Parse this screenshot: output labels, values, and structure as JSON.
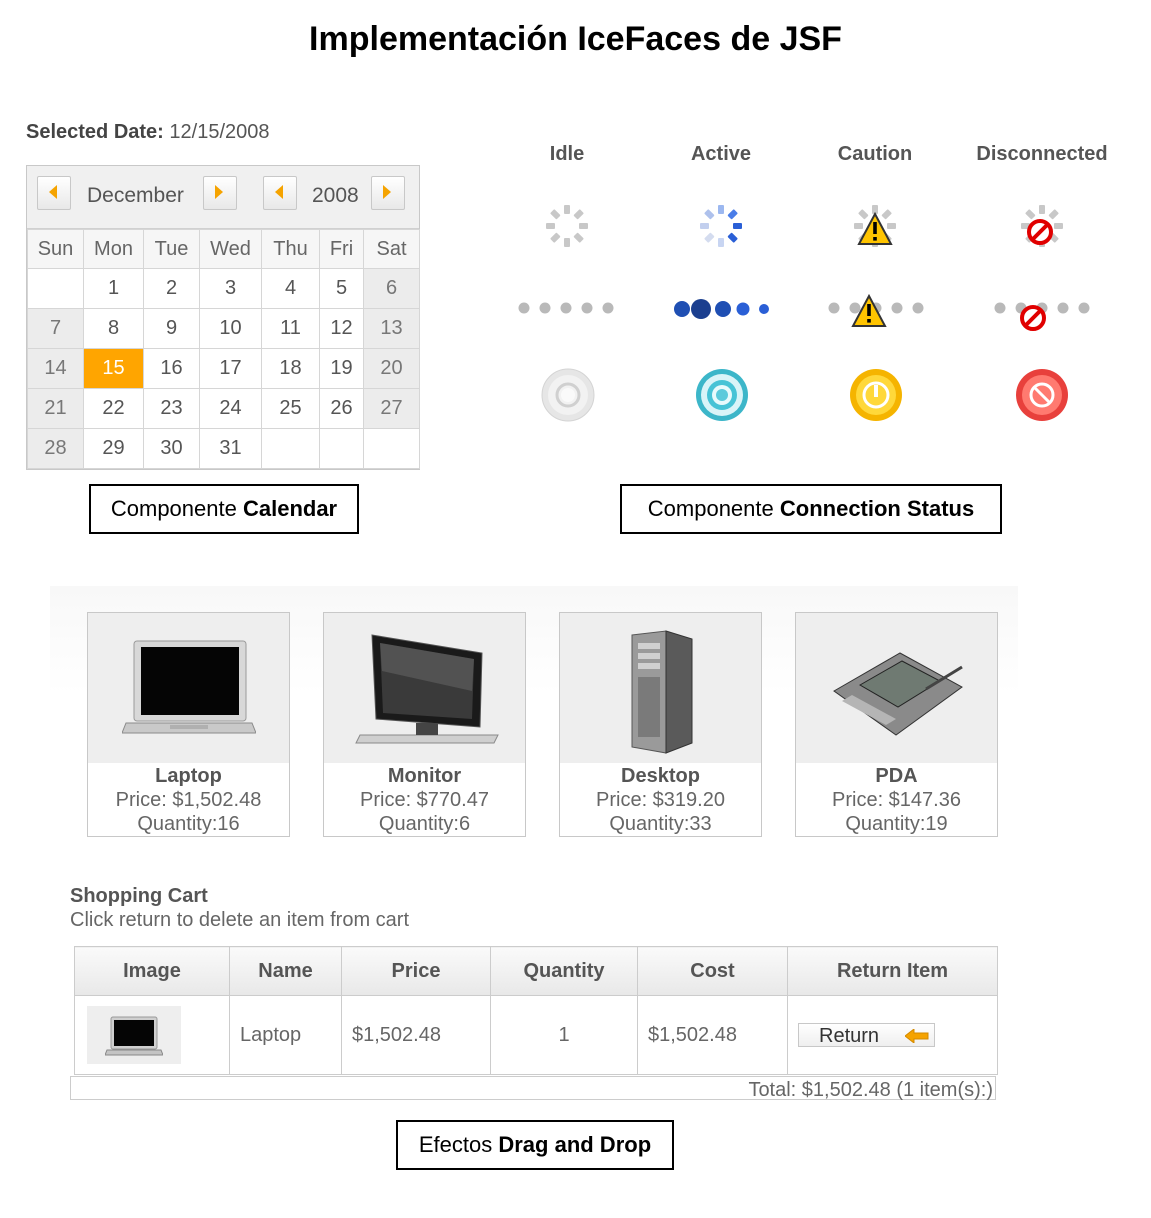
{
  "title": "Implementación IceFaces de JSF",
  "calendar": {
    "selected_label": "Selected Date:",
    "selected_value": "12/15/2008",
    "month": "December",
    "year": "2008",
    "weekdays": [
      "Sun",
      "Mon",
      "Tue",
      "Wed",
      "Thu",
      "Fri",
      "Sat"
    ],
    "weeks": [
      [
        "",
        "1",
        "2",
        "3",
        "4",
        "5",
        "6"
      ],
      [
        "7",
        "8",
        "9",
        "10",
        "11",
        "12",
        "13"
      ],
      [
        "14",
        "15",
        "16",
        "17",
        "18",
        "19",
        "20"
      ],
      [
        "21",
        "22",
        "23",
        "24",
        "25",
        "26",
        "27"
      ],
      [
        "28",
        "29",
        "30",
        "31",
        "",
        "",
        ""
      ]
    ],
    "selected_day": "15",
    "caption_prefix": "Componente ",
    "caption_bold": "Calendar"
  },
  "connection_status": {
    "states": [
      "Idle",
      "Active",
      "Caution",
      "Disconnected"
    ],
    "colors": {
      "idle": "#c8c8c8",
      "active": "#2a5fd6",
      "caution": "#ffc400",
      "disconnected": "#e8323a"
    },
    "caption_prefix": "Componente ",
    "caption_bold": "Connection Status"
  },
  "products": [
    {
      "name": "Laptop",
      "price": "Price: $1,502.48",
      "quantity": "Quantity:16",
      "icon": "laptop-icon"
    },
    {
      "name": "Monitor",
      "price": "Price: $770.47",
      "quantity": "Quantity:6",
      "icon": "monitor-icon"
    },
    {
      "name": "Desktop",
      "price": "Price: $319.20",
      "quantity": "Quantity:33",
      "icon": "desktop-tower-icon"
    },
    {
      "name": "PDA",
      "price": "Price: $147.36",
      "quantity": "Quantity:19",
      "icon": "pda-icon"
    }
  ],
  "cart": {
    "title": "Shopping Cart",
    "subtitle": "Click return to delete an item from cart",
    "headers": [
      "Image",
      "Name",
      "Price",
      "Quantity",
      "Cost",
      "Return Item"
    ],
    "rows": [
      {
        "name": "Laptop",
        "price": "$1,502.48",
        "quantity": "1",
        "cost": "$1,502.48",
        "button": "Return"
      }
    ],
    "total": "Total: $1,502.48 (1 item(s):)"
  },
  "dnd_caption": {
    "prefix": "Efectos ",
    "bold": "Drag and Drop"
  }
}
